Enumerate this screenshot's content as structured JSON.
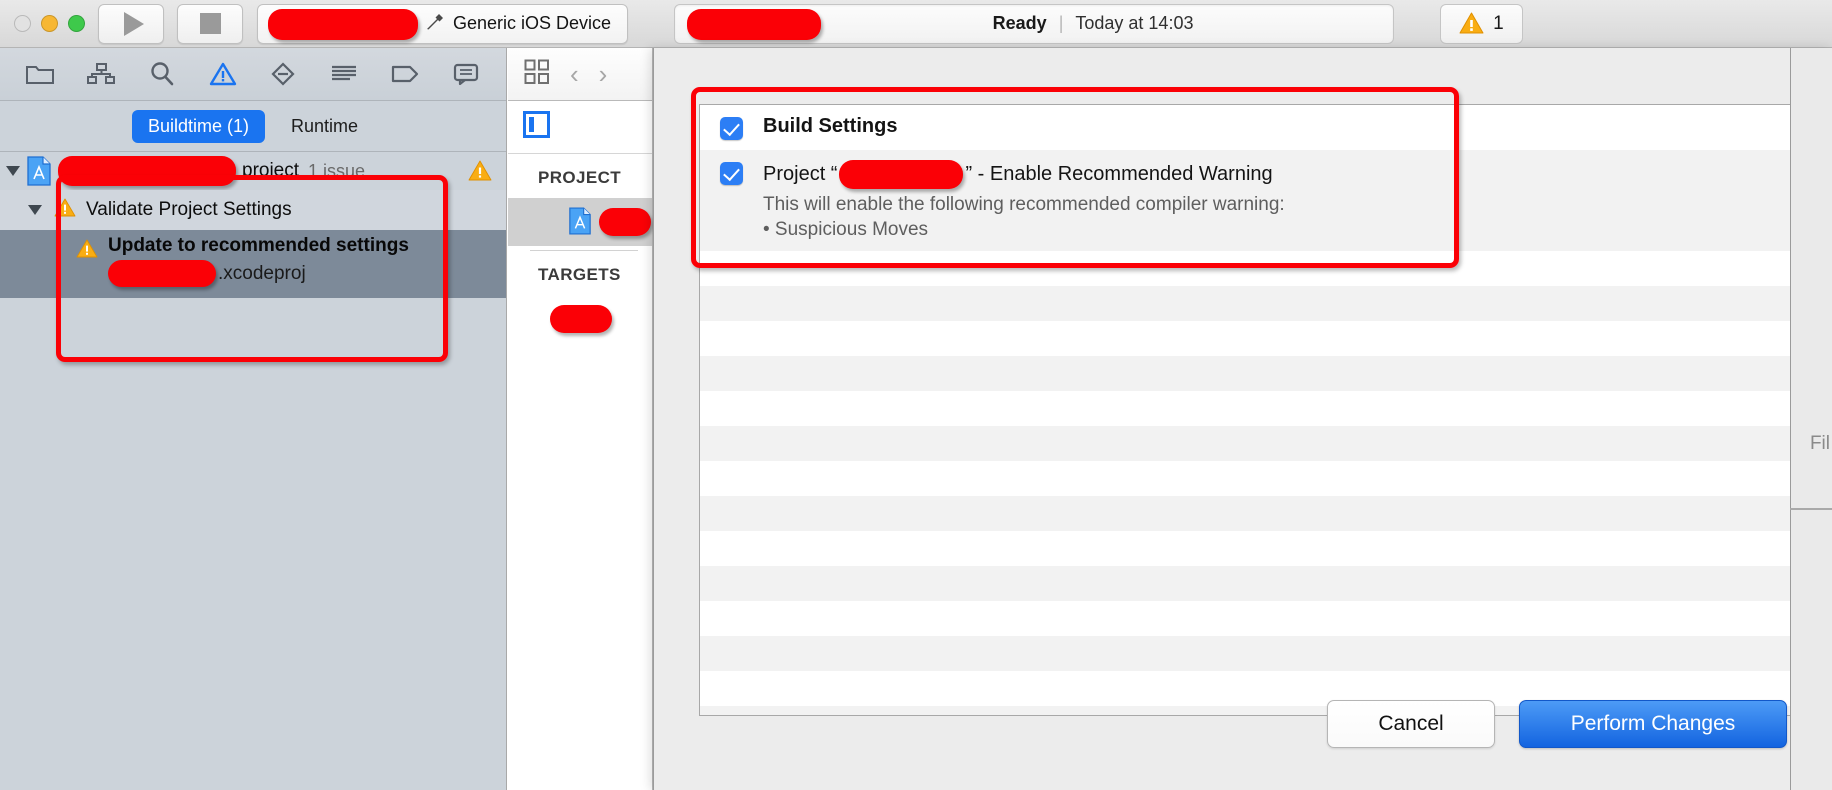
{
  "window": {
    "traffic_lights": [
      "close",
      "minimize",
      "zoom"
    ]
  },
  "toolbar": {
    "run_button": "run-icon",
    "stop_button": "stop-icon",
    "scheme_name": "",
    "scheme_separator": "〉",
    "destination_icon": "hammer-icon",
    "destination_name": "Generic iOS Device",
    "status_project": "",
    "status_state": "Ready",
    "status_separator": "|",
    "status_time": "Today at 14:03",
    "warning_count": "1"
  },
  "navigator": {
    "icons": [
      {
        "name": "folder-icon",
        "glyph": "folder"
      },
      {
        "name": "source-control-icon",
        "glyph": "hierarchy"
      },
      {
        "name": "search-icon",
        "glyph": "magnifier"
      },
      {
        "name": "issue-navigator-icon",
        "glyph": "warning-triangle"
      },
      {
        "name": "test-navigator-icon",
        "glyph": "diamond-minus"
      },
      {
        "name": "debug-navigator-icon",
        "glyph": "lines"
      },
      {
        "name": "breakpoint-navigator-icon",
        "glyph": "tag"
      },
      {
        "name": "report-navigator-icon",
        "glyph": "speech-bubble"
      }
    ],
    "tabs": [
      {
        "label": "Buildtime (1)",
        "active": true
      },
      {
        "label": "Runtime",
        "active": false
      }
    ],
    "tree": [
      {
        "label": "project",
        "detail": "1 issue",
        "redacted": true,
        "badge": "warning"
      },
      {
        "label": "Validate Project Settings",
        "detail": "",
        "redacted": false,
        "badge": "warning"
      },
      {
        "label": "Update to recommended settings",
        "detail": ".xcodeproj",
        "redacted": true,
        "badge": "warning",
        "selected": true
      }
    ]
  },
  "editor": {
    "jumpbar": {
      "grid_icon": "grid-icon",
      "back_arrow": "‹",
      "forward_arrow": "›"
    },
    "filter_icon": "panel-toggle-icon",
    "project_header": "PROJECT",
    "project_item": "",
    "targets_header": "TARGETS",
    "target_item": ""
  },
  "dialog": {
    "options": [
      {
        "checked": true,
        "title": "Build Settings",
        "bold": true,
        "description": "",
        "bullets": []
      },
      {
        "checked": true,
        "title_prefix": "Project “",
        "title_redacted": true,
        "title_suffix": "” - Enable Recommended Warning",
        "description": "This will enable the following recommended compiler warning:",
        "bullets": [
          "• Suspicious Moves"
        ]
      }
    ],
    "cancel_label": "Cancel",
    "primary_label": "Perform Changes"
  },
  "utility_panel": {
    "label": "Fil"
  },
  "colors": {
    "accent_blue": "#1a74f0",
    "primary_button": "#1364e0",
    "annotation_red": "#fb0006",
    "warning_amber": "#f9ad13",
    "navigator_bg": "#ccd3da",
    "selection_row": "#7d8a99"
  }
}
